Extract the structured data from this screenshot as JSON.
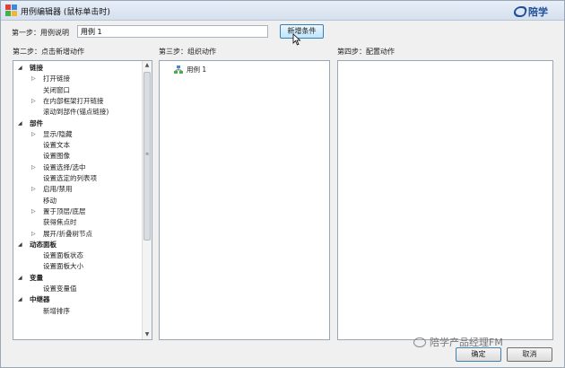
{
  "window": {
    "title": "用例编辑器 (鼠标单击时)",
    "brand": "陪学"
  },
  "step1": {
    "label": "第一步：用例说明",
    "input_value": "用例 1",
    "add_condition_label": "新增条件"
  },
  "step2": {
    "label": "第二步：点击新增动作",
    "tree": [
      {
        "text": "链接",
        "type": "category",
        "expanded": true
      },
      {
        "text": "打开链接",
        "type": "item",
        "expandable": true
      },
      {
        "text": "关闭窗口",
        "type": "item",
        "expandable": false
      },
      {
        "text": "在内部框架打开链接",
        "type": "item",
        "expandable": true
      },
      {
        "text": "滚动到部件(锚点链接)",
        "type": "item",
        "expandable": false
      },
      {
        "text": "部件",
        "type": "category",
        "expanded": true
      },
      {
        "text": "显示/隐藏",
        "type": "item",
        "expandable": true
      },
      {
        "text": "设置文本",
        "type": "item",
        "expandable": false
      },
      {
        "text": "设置图像",
        "type": "item",
        "expandable": false
      },
      {
        "text": "设置选择/选中",
        "type": "item",
        "expandable": true
      },
      {
        "text": "设置选定的列表项",
        "type": "item",
        "expandable": false
      },
      {
        "text": "启用/禁用",
        "type": "item",
        "expandable": true
      },
      {
        "text": "移动",
        "type": "item",
        "expandable": false
      },
      {
        "text": "置于顶层/底层",
        "type": "item",
        "expandable": true
      },
      {
        "text": "获得焦点时",
        "type": "item",
        "expandable": false
      },
      {
        "text": "展开/折叠树节点",
        "type": "item",
        "expandable": true
      },
      {
        "text": "动态面板",
        "type": "category",
        "expanded": true
      },
      {
        "text": "设置面板状态",
        "type": "item",
        "expandable": false
      },
      {
        "text": "设置面板大小",
        "type": "item",
        "expandable": false
      },
      {
        "text": "变量",
        "type": "category",
        "expanded": true
      },
      {
        "text": "设置变量值",
        "type": "item",
        "expandable": false
      },
      {
        "text": "中继器",
        "type": "category",
        "expanded": true
      },
      {
        "text": "新增排序",
        "type": "item",
        "expandable": false
      }
    ]
  },
  "step3": {
    "label": "第三步：组织动作",
    "case_node": "用例 1"
  },
  "step4": {
    "label": "第四步：配置动作"
  },
  "watermark": "陪学产品经理FM",
  "buttons": {
    "ok": "确定",
    "cancel": "取消"
  },
  "icons": {
    "tree_expanded": "triangle-down-icon",
    "tree_collapsed": "triangle-right-icon",
    "case_node": "case-tree-icon"
  }
}
